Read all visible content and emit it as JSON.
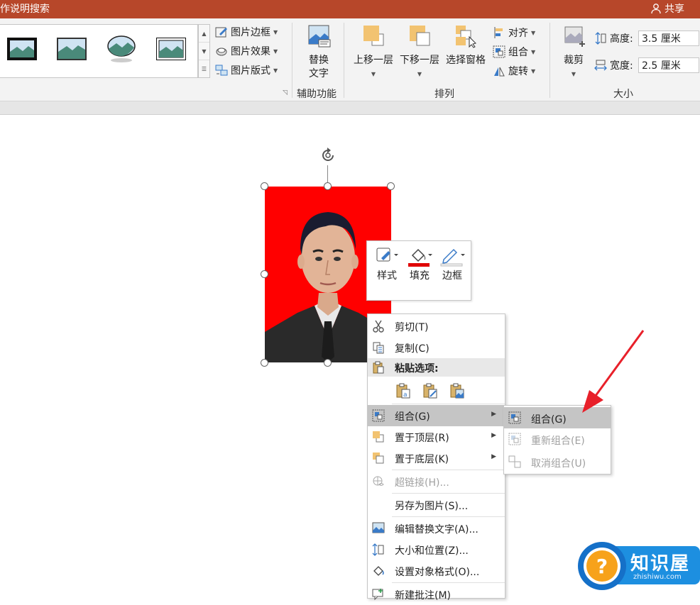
{
  "titlebar": {
    "tell_me": "作说明搜索",
    "share": "共享"
  },
  "ribbon": {
    "picture_styles": {
      "border_label": "图片边框",
      "effects_label": "图片效果",
      "layout_label": "图片版式"
    },
    "accessibility": {
      "alt_text_line1": "替换",
      "alt_text_line2": "文字",
      "group_label": "辅助功能"
    },
    "arrange": {
      "bring_forward": "上移一层",
      "send_backward": "下移一层",
      "selection_pane": "选择窗格",
      "align": "对齐",
      "group": "组合",
      "rotate": "旋转",
      "group_label": "排列"
    },
    "size": {
      "crop": "裁剪",
      "height_label": "高度:",
      "height_value": "3.5 厘米",
      "width_label": "宽度:",
      "width_value": "2.5 厘米",
      "group_label": "大小"
    }
  },
  "mini_toolbar": {
    "style": "样式",
    "fill": "填充",
    "outline": "边框",
    "fill_color": "#e00000"
  },
  "context_menu": {
    "cut": "剪切(T)",
    "copy": "复制(C)",
    "paste_options": "粘贴选项:",
    "group": "组合(G)",
    "bring_to_front": "置于顶层(R)",
    "send_to_back": "置于底层(K)",
    "hyperlink": "超链接(H)...",
    "save_as_picture": "另存为图片(S)...",
    "edit_alt_text": "编辑替换文字(A)...",
    "size_and_position": "大小和位置(Z)...",
    "format_object": "设置对象格式(O)...",
    "new_comment": "新建批注(M)"
  },
  "group_submenu": {
    "group": "组合(G)",
    "regroup": "重新组合(E)",
    "ungroup": "取消组合(U)"
  },
  "watermark": {
    "name": "知识屋",
    "url": "zhishiwu.com"
  },
  "colors": {
    "accent": "#b7472a",
    "photo_background": "#ff0000",
    "annotation_arrow": "#e8202a"
  }
}
